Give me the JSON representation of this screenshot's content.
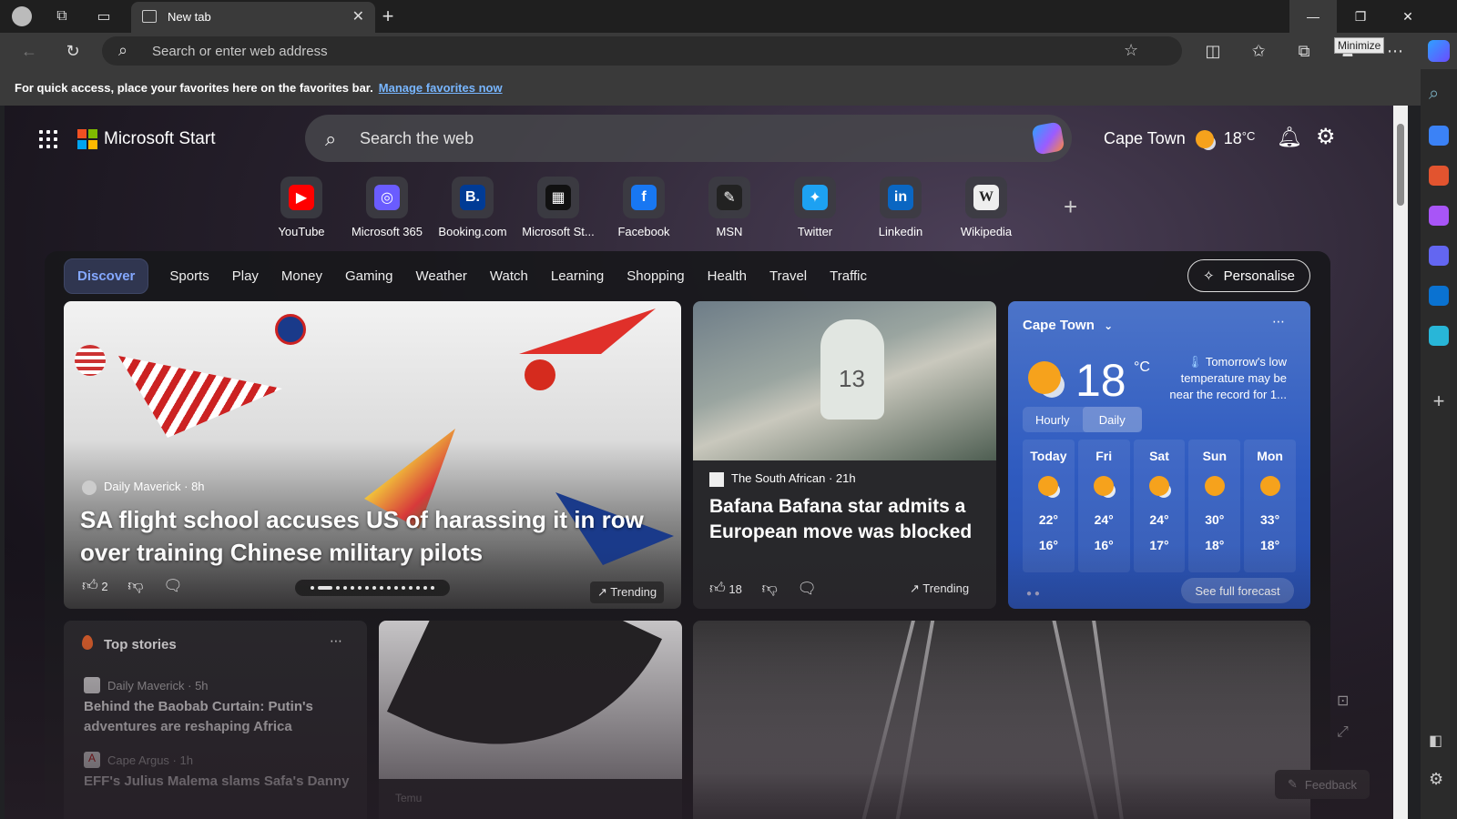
{
  "browser": {
    "tab_title": "New tab",
    "address_placeholder": "Search or enter web address",
    "tooltip": "Minimize",
    "favbar_message": "For quick access, place your favorites here on the favorites bar.",
    "favbar_link": "Manage favorites now"
  },
  "header": {
    "brand": "Microsoft Start",
    "search_placeholder": "Search the web",
    "city": "Cape Town",
    "temp": "18",
    "unit": "°C"
  },
  "quick_links": [
    {
      "label": "YouTube",
      "color": "#ff0000",
      "glyph": "▶"
    },
    {
      "label": "Microsoft 365",
      "color": "#6a5cff",
      "glyph": "◎"
    },
    {
      "label": "Booking.com",
      "color": "#003b95",
      "glyph": "B."
    },
    {
      "label": "Microsoft St...",
      "color": "#111111",
      "glyph": "▦"
    },
    {
      "label": "Facebook",
      "color": "#1877f2",
      "glyph": "f"
    },
    {
      "label": "MSN",
      "color": "#222222",
      "glyph": "✎"
    },
    {
      "label": "Twitter",
      "color": "#1da1f2",
      "glyph": "✦"
    },
    {
      "label": "Linkedin",
      "color": "#0a66c2",
      "glyph": "in"
    },
    {
      "label": "Wikipedia",
      "color": "#eeeeee",
      "glyph": "W"
    }
  ],
  "nav": {
    "tabs": [
      "Discover",
      "Sports",
      "Play",
      "Money",
      "Gaming",
      "Weather",
      "Watch",
      "Learning",
      "Shopping",
      "Health",
      "Travel",
      "Traffic"
    ],
    "personalise": "Personalise"
  },
  "hero": {
    "source": "Daily Maverick · 8h",
    "title": "SA flight school accuses US of harassing it in row over training Chinese military pilots",
    "likes": "2",
    "trending": "Trending"
  },
  "sport": {
    "source": "The South African · 21h",
    "title": "Bafana Bafana star admits a European move was blocked",
    "likes": "18",
    "trending": "Trending",
    "jersey": "13"
  },
  "weather": {
    "city": "Cape Town",
    "temp": "18",
    "unit": "°C",
    "alert": "Tomorrow's low temperature may be near the record for 1...",
    "hourly": "Hourly",
    "daily": "Daily",
    "days": [
      {
        "name": "Today",
        "hi": "22°",
        "lo": "16°"
      },
      {
        "name": "Fri",
        "hi": "24°",
        "lo": "16°"
      },
      {
        "name": "Sat",
        "hi": "24°",
        "lo": "17°"
      },
      {
        "name": "Sun",
        "hi": "30°",
        "lo": "18°"
      },
      {
        "name": "Mon",
        "hi": "33°",
        "lo": "18°"
      }
    ],
    "forecast_btn": "See full forecast"
  },
  "top_stories": {
    "header": "Top stories",
    "items": [
      {
        "source": "Daily Maverick · 5h",
        "title": "Behind the Baobab Curtain: Putin's adventures are reshaping Africa"
      },
      {
        "source": "Cape Argus · 1h",
        "title": "EFF's Julius Malema slams Safa's Danny"
      }
    ]
  },
  "umbrella_card": {
    "source": "Temu"
  },
  "feedback": "Feedback"
}
